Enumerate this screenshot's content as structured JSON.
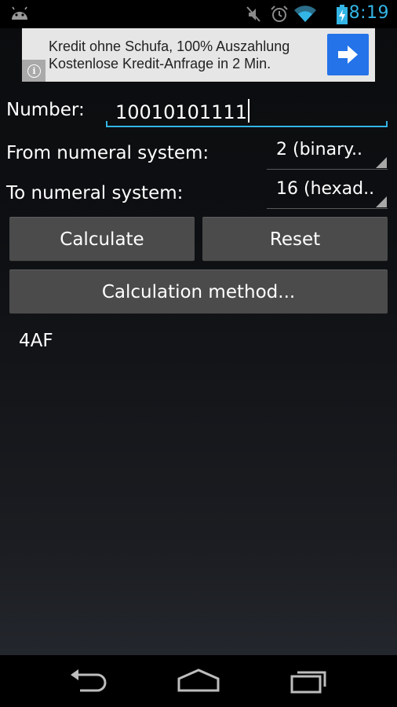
{
  "status_bar": {
    "time": "8:19",
    "icons": [
      "android-icon",
      "mute-icon",
      "alarm-icon",
      "wifi-icon",
      "battery-icon"
    ],
    "accent_color": "#33b5e5"
  },
  "ad": {
    "line1": "Kredit ohne Schufa, 100% Auszahlung",
    "line2": "Kostenlose Kredit-Anfrage in 2 Min.",
    "info_glyph": "i",
    "cta_icon": "arrow-right-icon",
    "cta_color": "#2473e8"
  },
  "form": {
    "number_label": "Number:",
    "number_value": "10010101111",
    "from_label": "From numeral system:",
    "from_value": "2 (binary..",
    "to_label": "To numeral system:",
    "to_value": "16 (hexad.."
  },
  "buttons": {
    "calculate": "Calculate",
    "reset": "Reset",
    "method": "Calculation method..."
  },
  "result": "4AF",
  "nav_bar": {
    "icons": [
      "back-icon",
      "home-icon",
      "recent-apps-icon"
    ]
  }
}
